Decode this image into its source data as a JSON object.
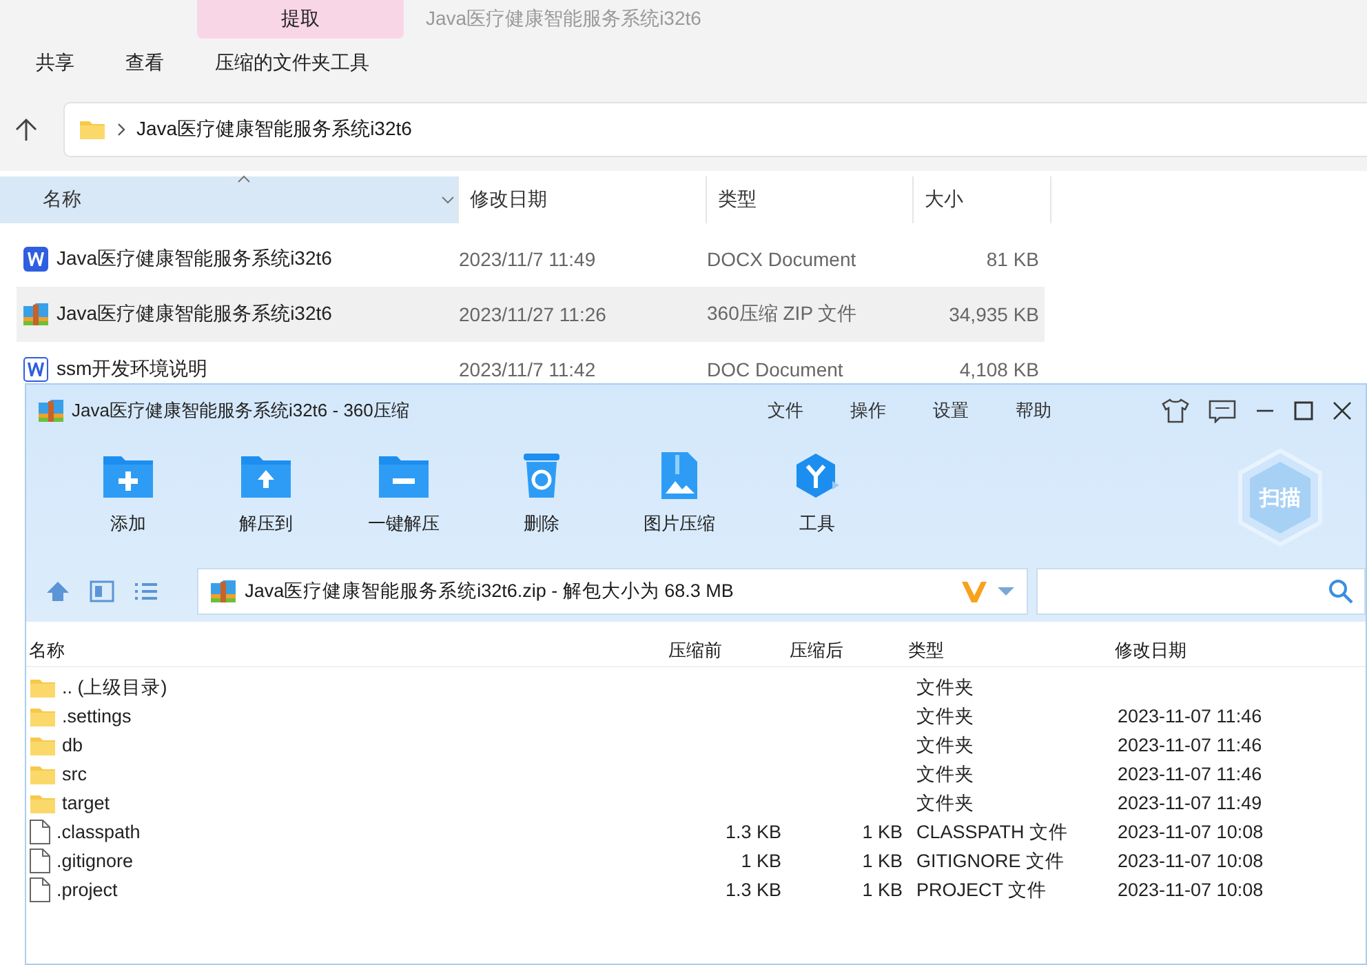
{
  "explorer": {
    "context_tab": {
      "label": "提取",
      "selected": true
    },
    "window_title": "Java医疗健康智能服务系统i32t6",
    "ribbon_tabs": [
      {
        "label": "共享",
        "selected": false
      },
      {
        "label": "查看",
        "selected": false
      },
      {
        "label": "压缩的文件夹工具",
        "selected": false
      }
    ],
    "address": {
      "path": "Java医疗健康智能服务系统i32t6"
    },
    "columns": [
      "名称",
      "修改日期",
      "类型",
      "大小"
    ],
    "files": [
      {
        "kind": "docx",
        "name": "Java医疗健康智能服务系统i32t6",
        "modified": "2023/11/7 11:49",
        "type": "DOCX Document",
        "size": "81 KB",
        "selected": false
      },
      {
        "kind": "zip",
        "name": "Java医疗健康智能服务系统i32t6",
        "modified": "2023/11/27 11:26",
        "type": "360压缩 ZIP 文件",
        "size": "34,935 KB",
        "selected": true
      },
      {
        "kind": "doc",
        "name": "ssm开发环境说明",
        "modified": "2023/11/7 11:42",
        "type": "DOC Document",
        "size": "4,108 KB",
        "selected": false
      }
    ]
  },
  "archiver": {
    "title": "Java医疗健康智能服务系统i32t6 - 360压缩",
    "menu": [
      "文件",
      "操作",
      "设置",
      "帮助"
    ],
    "toolbar": [
      {
        "kind": "add",
        "label": "添加"
      },
      {
        "kind": "extract",
        "label": "解压到"
      },
      {
        "kind": "quick",
        "label": "一键解压"
      },
      {
        "kind": "delete",
        "label": "删除"
      },
      {
        "kind": "image",
        "label": "图片压缩"
      },
      {
        "kind": "tools",
        "label": "工具"
      }
    ],
    "scan_label": "扫描",
    "path": "Java医疗健康智能服务系统i32t6.zip - 解包大小为 68.3 MB",
    "columns": [
      "名称",
      "压缩前",
      "压缩后",
      "类型",
      "修改日期"
    ],
    "entries": [
      {
        "kind": "folder",
        "name": ".. (上级目录)",
        "type": "文件夹"
      },
      {
        "kind": "folder",
        "name": ".settings",
        "type": "文件夹",
        "modified": "2023-11-07 11:46"
      },
      {
        "kind": "folder",
        "name": "db",
        "type": "文件夹",
        "modified": "2023-11-07 11:46"
      },
      {
        "kind": "folder",
        "name": "src",
        "type": "文件夹",
        "modified": "2023-11-07 11:46"
      },
      {
        "kind": "folder",
        "name": "target",
        "type": "文件夹",
        "modified": "2023-11-07 11:49"
      },
      {
        "kind": "file",
        "name": ".classpath",
        "before": "1.3 KB",
        "after": "1 KB",
        "type": "CLASSPATH 文件",
        "modified": "2023-11-07 10:08"
      },
      {
        "kind": "file",
        "name": ".gitignore",
        "before": "1 KB",
        "after": "1 KB",
        "type": "GITIGNORE 文件",
        "modified": "2023-11-07 10:08"
      },
      {
        "kind": "file",
        "name": ".project",
        "before": "1.3 KB",
        "after": "1 KB",
        "type": "PROJECT 文件",
        "modified": "2023-11-07 10:08"
      }
    ]
  }
}
